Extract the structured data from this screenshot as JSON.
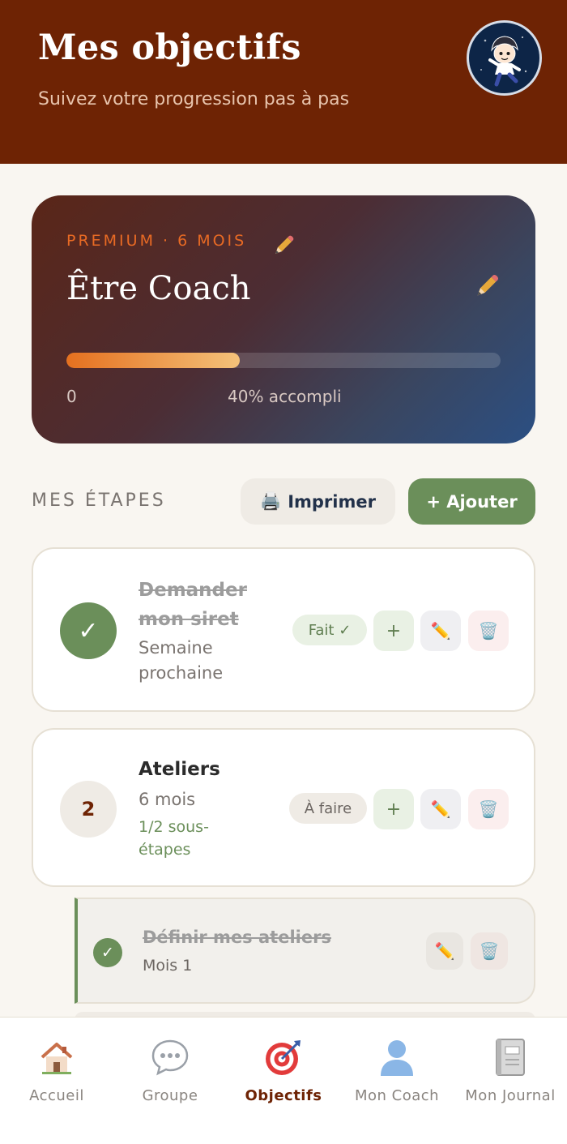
{
  "header": {
    "title": "Mes objectifs",
    "subtitle": "Suivez votre progression pas à pas",
    "avatar_icon": "boy-avatar-icon"
  },
  "goal": {
    "tag": "PREMIUM · 6 MOIS",
    "title": "Être Coach",
    "progress_fraction": 0.4,
    "progress_start": "0",
    "progress_label": "40% accompli"
  },
  "steps_section": {
    "title": "MES ÉTAPES",
    "print_icon": "🖨️",
    "print_label": "Imprimer",
    "add_label": "+ Ajouter"
  },
  "steps": [
    {
      "marker": "✓",
      "title_line1": "Demander",
      "title_line2": "mon siret",
      "sub_line1": "Semaine",
      "sub_line2": "prochaine",
      "status": "Fait ✓",
      "plus": "+",
      "edit_icon": "✏️",
      "delete_icon": "🗑️"
    },
    {
      "marker": "2",
      "title_line1": "Ateliers",
      "sub_line1": "6 mois",
      "substeps_line1": "1/2 sous-",
      "substeps_line2": "étapes",
      "status": "À faire",
      "plus": "+",
      "edit_icon": "✏️",
      "delete_icon": "🗑️"
    }
  ],
  "substep": {
    "marker": "✓",
    "title": "Définir mes ateliers",
    "sub": "Mois 1",
    "edit_icon": "✏️",
    "delete_icon": "🗑️"
  },
  "nav": [
    {
      "label": "Accueil",
      "icon": "🏠"
    },
    {
      "label": "Groupe",
      "icon": "💬"
    },
    {
      "label": "Objectifs",
      "icon": "🎯"
    },
    {
      "label": "Mon Coach",
      "icon": "👤"
    },
    {
      "label": "Mon Journal",
      "icon": "📓"
    }
  ],
  "colors": {
    "header_bg": "#6e2304",
    "accent_green": "#6b8f5a",
    "accent_orange": "#e86a24"
  }
}
